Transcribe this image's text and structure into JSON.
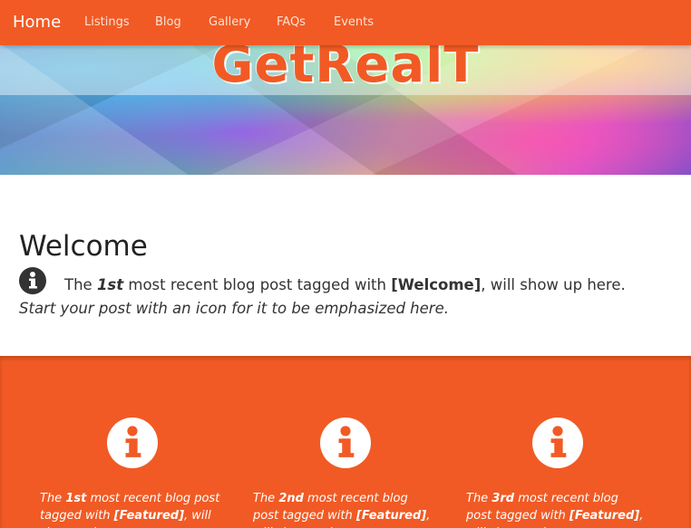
{
  "nav": {
    "brand": "Home",
    "items": [
      "Listings",
      "Blog",
      "Gallery",
      "FAQs",
      "Events"
    ]
  },
  "hero": {
    "title": "GetRealT"
  },
  "welcome": {
    "heading": "Welcome",
    "icon": "info-circle-icon",
    "line": {
      "pre": "The ",
      "rank": "1st",
      "mid": " most recent blog post tagged with ",
      "tag": "[Welcome]",
      "post": ", will show up here."
    },
    "sub": "Start your post with an icon for it to be emphasized here."
  },
  "featured": {
    "items": [
      {
        "icon": "info-circle-icon",
        "pre": "The ",
        "rank": "1st",
        "mid": " most recent blog post tagged with ",
        "tag": "[Featured]",
        "post": ", will show up here."
      },
      {
        "icon": "info-circle-icon",
        "pre": "The ",
        "rank": "2nd",
        "mid": " most recent blog post tagged with ",
        "tag": "[Featured]",
        "post": ", will show up here."
      },
      {
        "icon": "info-circle-icon",
        "pre": "The ",
        "rank": "3rd",
        "mid": " most recent blog post tagged with ",
        "tag": "[Featured]",
        "post": ", will show up here."
      }
    ]
  },
  "colors": {
    "accent": "#f15a24",
    "text": "#333333"
  }
}
